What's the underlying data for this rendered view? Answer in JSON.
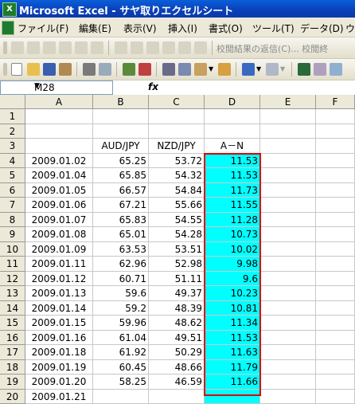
{
  "window": {
    "title": "Microsoft Excel - サヤ取りエクセルシート",
    "logo_text": "X"
  },
  "menu": [
    "ファイル(F)",
    "編集(E)",
    "表示(V)",
    "挿入(I)",
    "書式(O)",
    "ツール(T)",
    "データ(D)",
    "ウ"
  ],
  "toolbar": {
    "review_text": "校閲結果の返信(C)... 校閲終"
  },
  "formula_bar": {
    "name_box": "M28",
    "fx": "fx"
  },
  "columns": [
    "A",
    "B",
    "C",
    "D",
    "E",
    "F"
  ],
  "header_row": {
    "b": "AUD/JPY",
    "c": "NZD/JPY",
    "d": "A－N"
  },
  "rows": [
    {
      "n": "1",
      "a": "",
      "b": "",
      "c": "",
      "d": ""
    },
    {
      "n": "2",
      "a": "",
      "b": "",
      "c": "",
      "d": ""
    },
    {
      "n": "3",
      "a": "",
      "b": "AUD/JPY",
      "c": "NZD/JPY",
      "d": "A－N"
    },
    {
      "n": "4",
      "a": "2009.01.02",
      "b": "65.25",
      "c": "53.72",
      "d": "11.53"
    },
    {
      "n": "5",
      "a": "2009.01.04",
      "b": "65.85",
      "c": "54.32",
      "d": "11.53"
    },
    {
      "n": "6",
      "a": "2009.01.05",
      "b": "66.57",
      "c": "54.84",
      "d": "11.73"
    },
    {
      "n": "7",
      "a": "2009.01.06",
      "b": "67.21",
      "c": "55.66",
      "d": "11.55"
    },
    {
      "n": "8",
      "a": "2009.01.07",
      "b": "65.83",
      "c": "54.55",
      "d": "11.28"
    },
    {
      "n": "9",
      "a": "2009.01.08",
      "b": "65.01",
      "c": "54.28",
      "d": "10.73"
    },
    {
      "n": "10",
      "a": "2009.01.09",
      "b": "63.53",
      "c": "53.51",
      "d": "10.02"
    },
    {
      "n": "11",
      "a": "2009.01.11",
      "b": "62.96",
      "c": "52.98",
      "d": "9.98"
    },
    {
      "n": "12",
      "a": "2009.01.12",
      "b": "60.71",
      "c": "51.11",
      "d": "9.6"
    },
    {
      "n": "13",
      "a": "2009.01.13",
      "b": "59.6",
      "c": "49.37",
      "d": "10.23"
    },
    {
      "n": "14",
      "a": "2009.01.14",
      "b": "59.2",
      "c": "48.39",
      "d": "10.81"
    },
    {
      "n": "15",
      "a": "2009.01.15",
      "b": "59.96",
      "c": "48.62",
      "d": "11.34"
    },
    {
      "n": "16",
      "a": "2009.01.16",
      "b": "61.04",
      "c": "49.51",
      "d": "11.53"
    },
    {
      "n": "17",
      "a": "2009.01.18",
      "b": "61.92",
      "c": "50.29",
      "d": "11.63"
    },
    {
      "n": "18",
      "a": "2009.01.19",
      "b": "60.45",
      "c": "48.66",
      "d": "11.79"
    },
    {
      "n": "19",
      "a": "2009.01.20",
      "b": "58.25",
      "c": "46.59",
      "d": "11.66"
    },
    {
      "n": "20",
      "a": "2009.01.21",
      "b": "",
      "c": "",
      "d": ""
    }
  ],
  "colors": {
    "highlight": "#00ffff",
    "selection_border": "#e00000"
  }
}
